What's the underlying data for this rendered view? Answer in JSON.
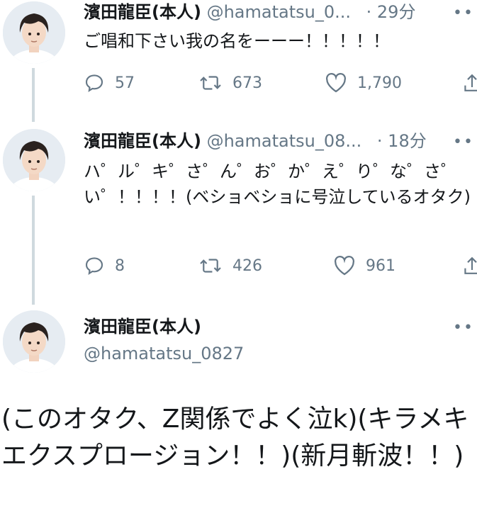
{
  "tweets": [
    {
      "display_name": "濱田龍臣(本人)",
      "handle": "@hamatatsu_0...",
      "separator": "·",
      "time": "29分",
      "text": "ご唱和下さい我の名をーーー！！！！！",
      "replies": "57",
      "retweets": "673",
      "likes": "1,790"
    },
    {
      "display_name": "濱田龍臣(本人)",
      "handle": "@hamatatsu_08...",
      "separator": "·",
      "time": "18分",
      "text": "ハ゜ル゜キ゜さ゜ん゜お゜か゜え゜り゜な゜さ゜い゜！！！！(ベショベショに号泣しているオタク)",
      "replies": "8",
      "retweets": "426",
      "likes": "961"
    },
    {
      "display_name": "濱田龍臣(本人)",
      "handle": "@hamatatsu_0827",
      "text": "(このオタク、Z関係でよく泣k)(キラメキエクスプロージョン！！)(新月斬波！！)"
    }
  ],
  "more_icon": "more-horizontal-icon",
  "colors": {
    "text": "#14171a",
    "muted": "#657786",
    "thread_line": "#cfd9de"
  }
}
